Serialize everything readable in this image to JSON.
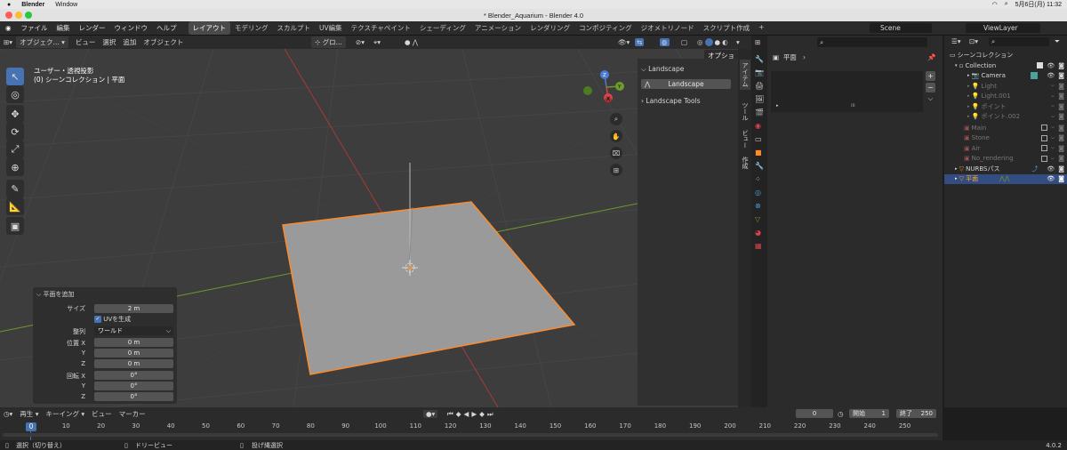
{
  "mac": {
    "app": "Blender",
    "menu_window": "Window",
    "clock": "5月6日(月) 11:32"
  },
  "window": {
    "title": "* Blender_Aquarium - Blender 4.0"
  },
  "topbar": {
    "menus": [
      "ファイル",
      "編集",
      "レンダー",
      "ウィンドウ",
      "ヘルプ"
    ],
    "workspaces": [
      "レイアウト",
      "モデリング",
      "スカルプト",
      "UV編集",
      "テクスチャペイント",
      "シェーディング",
      "アニメーション",
      "レンダリング",
      "コンポジティング",
      "ジオメトリノード",
      "スクリプト作成"
    ],
    "active_workspace": 0,
    "scene": "Scene",
    "view_layer": "ViewLayer"
  },
  "viewport_header": {
    "mode": "オブジェク...",
    "menus": [
      "ビュー",
      "選択",
      "追加",
      "オブジェクト"
    ],
    "orientation": "グロ...",
    "options": "オプション"
  },
  "viewport": {
    "view_name": "ユーザー・透視投影",
    "collection_info": "(0) シーンコレクション | 平面"
  },
  "npanel": {
    "section1": "Landscape",
    "button": "Landscape",
    "section2": "Landscape Tools",
    "tabs": [
      "アイテム",
      "ツール",
      "ビュー",
      "作成"
    ]
  },
  "properties": {
    "breadcrumb": "平面"
  },
  "operator_panel": {
    "title": "平面を追加",
    "size_label": "サイズ",
    "size_value": "2 m",
    "uv_label": "UVを生成",
    "align_label": "整列",
    "align_value": "ワールド",
    "loc_label": "位置 X",
    "y_label": "Y",
    "z_label": "Z",
    "loc_x": "0 m",
    "loc_y": "0 m",
    "loc_z": "0 m",
    "rot_label": "回転 X",
    "rot_x": "0°",
    "rot_y": "0°",
    "rot_z": "0°"
  },
  "outliner": {
    "title": "シーンコレクション",
    "items": [
      {
        "name": "Collection"
      },
      {
        "name": "Camera"
      },
      {
        "name": "Light"
      },
      {
        "name": "Light.001"
      },
      {
        "name": "ポイント"
      },
      {
        "name": "ポイント.002"
      },
      {
        "name": "Main"
      },
      {
        "name": "Stone"
      },
      {
        "name": "Air"
      },
      {
        "name": "No_rendering"
      },
      {
        "name": "NURBSパス"
      },
      {
        "name": "平面"
      }
    ]
  },
  "timeline": {
    "menus": [
      "再生",
      "キーイング",
      "ビュー",
      "マーカー"
    ],
    "current_frame": "0",
    "start_label": "開始",
    "start": "1",
    "end_label": "終了",
    "end": "250",
    "ticks": [
      "0",
      "10",
      "20",
      "30",
      "40",
      "50",
      "60",
      "70",
      "80",
      "90",
      "100",
      "110",
      "120",
      "130",
      "140",
      "150",
      "160",
      "170",
      "180",
      "190",
      "200",
      "210",
      "220",
      "230",
      "240",
      "250"
    ],
    "cursor": "0"
  },
  "status": {
    "select": "選択（切り替え）",
    "dolly": "ドリービュー",
    "lasso": "投げ縄選択",
    "version": "4.0.2"
  },
  "colors": {
    "accent": "#4772b3",
    "selection": "#ff8a2a",
    "x_axis": "#a83a3a",
    "y_axis": "#6e9b2a"
  }
}
